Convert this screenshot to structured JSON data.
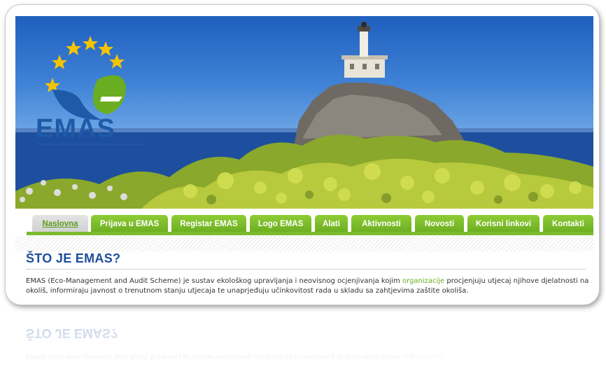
{
  "logo": {
    "text": "EMAS",
    "star_color": "#f5c400",
    "text_color": "#1e5aa8",
    "leaf_color": "#6aad20"
  },
  "nav": {
    "tabs": [
      {
        "label": "Naslovna",
        "active": true
      },
      {
        "label": "Prijava u EMAS",
        "active": false
      },
      {
        "label": "Registar EMAS",
        "active": false
      },
      {
        "label": "Logo EMAS",
        "active": false
      },
      {
        "label": "Alati",
        "active": false
      },
      {
        "label": "Aktivnosti",
        "active": false
      },
      {
        "label": "Novosti",
        "active": false
      },
      {
        "label": "Korisni linkovi",
        "active": false
      },
      {
        "label": "Kontakti",
        "active": false
      }
    ],
    "accent_color": "#7bbc2e"
  },
  "content": {
    "heading": "ŠTO JE EMAS?",
    "paragraph_before_link": "EMAS (Eco-Management and Audit Scheme) je sustav ekološkog upravljanja i neovisnog ocjenjivanja kojim ",
    "paragraph_link": "organizacije",
    "paragraph_after_link": " procjenjuju utjecaj njihove djelatnosti na okoliš, informiraju javnost o trenutnom stanju utjecaja te unaprjeđuju učinkovitost rada u skladu sa zahtjevima zaštite okoliša.",
    "heading_color": "#1e4f9c"
  }
}
